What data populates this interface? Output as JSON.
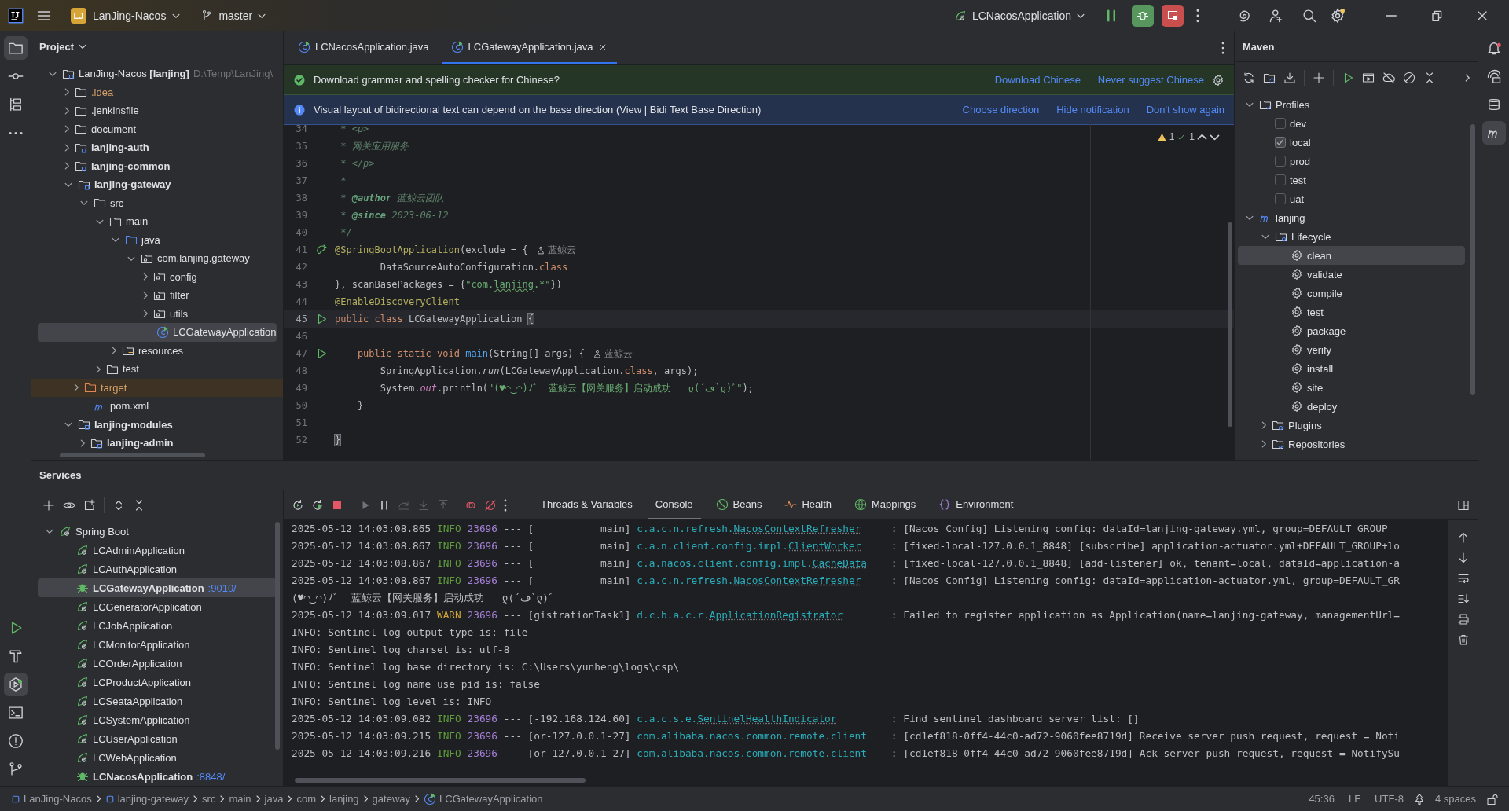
{
  "toolbar": {
    "project_badge": "LJ",
    "project": "LanJing-Nacos",
    "branch": "master",
    "run_config": "LCNacosApplication"
  },
  "project": {
    "title": "Project",
    "tree": [
      {
        "label": "LanJing-Nacos **[lanjing]**",
        "path": "D:\\Temp\\LanJing\\",
        "kind": "project",
        "expanded": true,
        "selected": false,
        "children": [
          {
            "label": ".idea",
            "kind": "ignored-folder",
            "expanded": false,
            "selected": false
          },
          {
            "label": ".jenkinsfile",
            "kind": "folder",
            "expanded": false,
            "selected": false
          },
          {
            "label": "document",
            "kind": "folder",
            "expanded": false,
            "selected": false
          },
          {
            "label": "lanjing-auth",
            "kind": "module",
            "expanded": false,
            "selected": false
          },
          {
            "label": "lanjing-common",
            "kind": "module",
            "expanded": false,
            "selected": false
          },
          {
            "label": "lanjing-gateway",
            "kind": "module",
            "expanded": true,
            "selected": false,
            "children": [
              {
                "label": "src",
                "kind": "folder",
                "expanded": true,
                "selected": false,
                "children": [
                  {
                    "label": "main",
                    "kind": "folder",
                    "expanded": true,
                    "selected": false,
                    "children": [
                      {
                        "label": "java",
                        "kind": "source-root",
                        "expanded": true,
                        "selected": false,
                        "children": [
                          {
                            "label": "com.lanjing.gateway",
                            "kind": "package",
                            "expanded": true,
                            "selected": false,
                            "children": [
                              {
                                "label": "config",
                                "kind": "package",
                                "expanded": false,
                                "selected": false
                              },
                              {
                                "label": "filter",
                                "kind": "package",
                                "expanded": false,
                                "selected": false
                              },
                              {
                                "label": "utils",
                                "kind": "package",
                                "expanded": false,
                                "selected": false
                              },
                              {
                                "label": "LCGatewayApplication",
                                "kind": "class",
                                "selected": true
                              }
                            ]
                          }
                        ]
                      },
                      {
                        "label": "resources",
                        "kind": "resources",
                        "expanded": false,
                        "selected": false
                      }
                    ]
                  },
                  {
                    "label": "test",
                    "kind": "folder",
                    "expanded": false,
                    "selected": false
                  }
                ]
              },
              {
                "label": "target",
                "kind": "excluded-folder",
                "expanded": false,
                "selected": false
              },
              {
                "label": "pom.xml",
                "kind": "maven-file",
                "selected": false
              }
            ]
          },
          {
            "label": "lanjing-modules",
            "kind": "module",
            "expanded": true,
            "selected": false,
            "children": [
              {
                "label": "lanjing-admin",
                "kind": "module",
                "expanded": false,
                "selected": false
              }
            ]
          }
        ]
      }
    ]
  },
  "editor": {
    "tabs": [
      {
        "label": "LCNacosApplication.java",
        "selected": false,
        "closable": false
      },
      {
        "label": "LCGatewayApplication.java",
        "selected": true,
        "closable": true
      }
    ],
    "notifications": [
      {
        "kind": "success",
        "text": "Download grammar and spelling checker for Chinese?",
        "actions": [
          "Download Chinese",
          "Never suggest Chinese"
        ],
        "settings": true
      },
      {
        "kind": "info",
        "text": "Visual layout of bidirectional text can depend on the base direction (View | Bidi Text Base Direction)",
        "actions": [
          "Choose direction",
          "Hide notification",
          "Don't show again"
        ],
        "settings": false
      }
    ],
    "inspections": {
      "warnings": "1",
      "checks": "1"
    },
    "lines": [
      {
        "number": "34",
        "current": false,
        "tokens": [
          {
            "kind": "doc",
            "text": " * <p>"
          }
        ]
      },
      {
        "number": "35",
        "current": false,
        "tokens": [
          {
            "kind": "doc",
            "text": " * 网关应用服务"
          }
        ]
      },
      {
        "number": "36",
        "current": false,
        "tokens": [
          {
            "kind": "doc",
            "text": " * </p>"
          }
        ]
      },
      {
        "number": "37",
        "current": false,
        "tokens": [
          {
            "kind": "doc",
            "text": " *"
          }
        ]
      },
      {
        "number": "38",
        "current": false,
        "tokens": [
          {
            "kind": "doc",
            "text": " * "
          },
          {
            "kind": "doctag",
            "text": "@author"
          },
          {
            "kind": "doc",
            "text": " 蓝鲸云团队"
          }
        ]
      },
      {
        "number": "39",
        "current": false,
        "tokens": [
          {
            "kind": "doc",
            "text": " * "
          },
          {
            "kind": "doctag",
            "text": "@since"
          },
          {
            "kind": "doc",
            "text": " 2023-06-12"
          }
        ]
      },
      {
        "number": "40",
        "current": false,
        "tokens": [
          {
            "kind": "doc",
            "text": " */"
          }
        ]
      },
      {
        "number": "41",
        "current": false,
        "gutter": {
          "kind": "bean"
        },
        "hint": "蓝鲸云",
        "tokens": [
          {
            "kind": "annotation",
            "text": "@SpringBootApplication"
          },
          {
            "kind": "plain",
            "text": "(exclude = {"
          }
        ]
      },
      {
        "number": "42",
        "current": false,
        "tokens": [
          {
            "kind": "plain",
            "text": "        DataSourceAutoConfiguration."
          },
          {
            "kind": "keyword",
            "text": "class"
          }
        ]
      },
      {
        "number": "43",
        "current": false,
        "tokens": [
          {
            "kind": "plain",
            "text": "}, scanBasePackages = {"
          },
          {
            "kind": "string",
            "text": "\"com."
          },
          {
            "kind": "typo",
            "text": "lanjing"
          },
          {
            "kind": "string",
            "text": ".*\""
          },
          {
            "kind": "plain",
            "text": "})"
          }
        ]
      },
      {
        "number": "44",
        "current": false,
        "tokens": [
          {
            "kind": "annotation",
            "text": "@EnableDiscoveryClient"
          }
        ]
      },
      {
        "number": "45",
        "current": true,
        "gutter": {
          "kind": "run"
        },
        "tokens": [
          {
            "kind": "keyword",
            "text": "public class "
          },
          {
            "kind": "plain",
            "text": "LCGatewayApplication "
          },
          {
            "kind": "brace",
            "text": "{"
          }
        ]
      },
      {
        "number": "46",
        "current": false
      },
      {
        "number": "47",
        "current": false,
        "gutter": {
          "kind": "run"
        },
        "hint": "蓝鲸云",
        "tokens": [
          {
            "kind": "keyword",
            "text": "    public static void "
          },
          {
            "kind": "method",
            "text": "main"
          },
          {
            "kind": "plain",
            "text": "(String[] args) {"
          }
        ]
      },
      {
        "number": "48",
        "current": false,
        "tokens": [
          {
            "kind": "plain",
            "text": "        SpringApplication."
          },
          {
            "kind": "static-call",
            "text": "run"
          },
          {
            "kind": "plain",
            "text": "(LCGatewayApplication."
          },
          {
            "kind": "keyword",
            "text": "class"
          },
          {
            "kind": "plain",
            "text": ", args);"
          }
        ]
      },
      {
        "number": "49",
        "current": false,
        "tokens": [
          {
            "kind": "plain",
            "text": "        System."
          },
          {
            "kind": "static-field",
            "text": "out"
          },
          {
            "kind": "plain",
            "text": ".println("
          },
          {
            "kind": "string",
            "text": "\"(♥◠‿◠)ﾉﾞ  蓝鲸云【网关服务】启动成功   ლ(´ڡ`ლ)ﾞ\""
          },
          {
            "kind": "plain",
            "text": ");"
          }
        ]
      },
      {
        "number": "50",
        "current": false,
        "tokens": [
          {
            "kind": "plain",
            "text": "    }"
          }
        ]
      },
      {
        "number": "51",
        "current": false
      },
      {
        "number": "52",
        "current": false,
        "tokens": [
          {
            "kind": "brace",
            "text": "}"
          }
        ]
      }
    ]
  },
  "maven": {
    "title": "Maven",
    "tree": [
      {
        "label": "Profiles",
        "kind": "profiles",
        "expanded": true,
        "selected": false,
        "children": [
          {
            "label": "dev",
            "kind": "profile",
            "checked": false,
            "selected": false
          },
          {
            "label": "local",
            "kind": "profile",
            "checked": true,
            "selected": false
          },
          {
            "label": "prod",
            "kind": "profile",
            "checked": false,
            "selected": false
          },
          {
            "label": "test",
            "kind": "profile",
            "checked": false,
            "selected": false
          },
          {
            "label": "uat",
            "kind": "profile",
            "checked": false,
            "selected": false
          }
        ]
      },
      {
        "label": "lanjing",
        "kind": "project",
        "expanded": true,
        "selected": false,
        "children": [
          {
            "label": "Lifecycle",
            "kind": "lifecycle",
            "expanded": true,
            "selected": false,
            "children": [
              {
                "label": "clean",
                "kind": "goal",
                "selected": true
              },
              {
                "label": "validate",
                "kind": "goal",
                "selected": false
              },
              {
                "label": "compile",
                "kind": "goal",
                "selected": false
              },
              {
                "label": "test",
                "kind": "goal",
                "selected": false
              },
              {
                "label": "package",
                "kind": "goal",
                "selected": false
              },
              {
                "label": "verify",
                "kind": "goal",
                "selected": false
              },
              {
                "label": "install",
                "kind": "goal",
                "selected": false
              },
              {
                "label": "site",
                "kind": "goal",
                "selected": false
              },
              {
                "label": "deploy",
                "kind": "goal",
                "selected": false
              }
            ]
          },
          {
            "label": "Plugins",
            "kind": "lifecycle",
            "expanded": false,
            "selected": false
          },
          {
            "label": "Repositories",
            "kind": "repositories",
            "expanded": false,
            "selected": false
          }
        ]
      }
    ]
  },
  "services": {
    "title": "Services",
    "tree": [
      {
        "label": "Spring Boot",
        "kind": "group",
        "expanded": true,
        "selected": false,
        "children": [
          {
            "label": "LCAdminApplication",
            "kind": "app",
            "running": false,
            "selected": false
          },
          {
            "label": "LCAuthApplication",
            "kind": "app",
            "running": false,
            "selected": false
          },
          {
            "label": "LCGatewayApplication",
            "kind": "app",
            "running": true,
            "port": ":9010/",
            "selected": true
          },
          {
            "label": "LCGeneratorApplication",
            "kind": "app",
            "running": false,
            "selected": false
          },
          {
            "label": "LCJobApplication",
            "kind": "app",
            "running": false,
            "selected": false
          },
          {
            "label": "LCMonitorApplication",
            "kind": "app",
            "running": false,
            "selected": false
          },
          {
            "label": "LCOrderApplication",
            "kind": "app",
            "running": false,
            "selected": false
          },
          {
            "label": "LCProductApplication",
            "kind": "app",
            "running": false,
            "selected": false
          },
          {
            "label": "LCSeataApplication",
            "kind": "app",
            "running": false,
            "selected": false
          },
          {
            "label": "LCSystemApplication",
            "kind": "app",
            "running": false,
            "selected": false
          },
          {
            "label": "LCUserApplication",
            "kind": "app",
            "running": false,
            "selected": false
          },
          {
            "label": "LCWebApplication",
            "kind": "app",
            "running": false,
            "selected": false
          },
          {
            "label": "LCNacosApplication",
            "kind": "app",
            "running": true,
            "port": ":8848/",
            "selected": false
          }
        ]
      }
    ]
  },
  "console": {
    "tabs": [
      {
        "label": "Threads & Variables",
        "kind": "threads",
        "selected": false
      },
      {
        "label": "Console",
        "kind": "console",
        "selected": true
      },
      {
        "label": "Beans",
        "kind": "beans",
        "selected": false
      },
      {
        "label": "Health",
        "kind": "health",
        "selected": false
      },
      {
        "label": "Mappings",
        "kind": "mappings",
        "selected": false
      },
      {
        "label": "Environment",
        "kind": "environment",
        "selected": false
      }
    ],
    "lines": [
      {
        "kind": "log",
        "time": "2025-05-12 14:03:08.865",
        "level": "INFO",
        "pid": "23696",
        "sep": "---",
        "thread": "[           main]",
        "logger": "c.a.c.n.refresh.",
        "logger_class": "NacosContextRefresher",
        "message": ": [Nacos Config] Listening config: dataId=lanjing-gateway.yml, group=DEFAULT_GROUP"
      },
      {
        "kind": "log",
        "time": "2025-05-12 14:03:08.867",
        "level": "INFO",
        "pid": "23696",
        "sep": "---",
        "thread": "[           main]",
        "logger": "c.a.n.client.config.impl.",
        "logger_class": "ClientWorker",
        "message": ": [fixed-local-127.0.0.1_8848] [subscribe] application-actuator.yml+DEFAULT_GROUP+lo"
      },
      {
        "kind": "log",
        "time": "2025-05-12 14:03:08.867",
        "level": "INFO",
        "pid": "23696",
        "sep": "---",
        "thread": "[           main]",
        "logger": "c.a.nacos.client.config.impl.",
        "logger_class": "CacheData",
        "message": ": [fixed-local-127.0.0.1_8848] [add-listener] ok, tenant=local, dataId=application-a"
      },
      {
        "kind": "log",
        "time": "2025-05-12 14:03:08.867",
        "level": "INFO",
        "pid": "23696",
        "sep": "---",
        "thread": "[           main]",
        "logger": "c.a.c.n.refresh.",
        "logger_class": "NacosContextRefresher",
        "message": ": [Nacos Config] Listening config: dataId=application-actuator.yml, group=DEFAULT_GR"
      },
      {
        "kind": "text",
        "text": "(♥◠‿◠)ﾉﾞ  蓝鲸云【网关服务】启动成功   ლ(´ڡ`ლ)ﾞ"
      },
      {
        "kind": "log",
        "time": "2025-05-12 14:03:09.017",
        "level": "WARN",
        "pid": "23696",
        "sep": "---",
        "thread": "[gistrationTask1]",
        "logger": "d.c.b.a.c.r.",
        "logger_class": "ApplicationRegistrator",
        "message": ": Failed to register application as Application(name=lanjing-gateway, managementUrl="
      },
      {
        "kind": "text",
        "text": "INFO: Sentinel log output type is: file"
      },
      {
        "kind": "text",
        "text": "INFO: Sentinel log charset is: utf-8"
      },
      {
        "kind": "text",
        "text": "INFO: Sentinel log base directory is: C:\\Users\\yunheng\\logs\\csp\\"
      },
      {
        "kind": "text",
        "text": "INFO: Sentinel log name use pid is: false"
      },
      {
        "kind": "text",
        "text": "INFO: Sentinel log level is: INFO"
      },
      {
        "kind": "log",
        "time": "2025-05-12 14:03:09.082",
        "level": "INFO",
        "pid": "23696",
        "sep": "---",
        "thread": "[-192.168.124.60]",
        "logger": "c.a.c.s.e.",
        "logger_class": "SentinelHealthIndicator",
        "message": ": Find sentinel dashboard server list: []"
      },
      {
        "kind": "log",
        "time": "2025-05-12 14:03:09.215",
        "level": "INFO",
        "pid": "23696",
        "sep": "---",
        "thread": "[or-127.0.0.1-27]",
        "logger": "com.alibaba.nacos.common.remote.client",
        "message": ": [cd1ef818-0ff4-44c0-ad72-9060fee8719d] Receive server push request, request = Noti"
      },
      {
        "kind": "log",
        "time": "2025-05-12 14:03:09.216",
        "level": "INFO",
        "pid": "23696",
        "sep": "---",
        "thread": "[or-127.0.0.1-27]",
        "logger": "com.alibaba.nacos.common.remote.client",
        "message": ": [cd1ef818-0ff4-44c0-ad72-9060fee8719d] Ack server push request, request = NotifySu"
      }
    ]
  },
  "status_bar": {
    "breadcrumbs": [
      {
        "label": "LanJing-Nacos",
        "kind": "module"
      },
      {
        "label": "lanjing-gateway",
        "kind": "module"
      },
      {
        "label": "src",
        "kind": "folder"
      },
      {
        "label": "main",
        "kind": "folder"
      },
      {
        "label": "java",
        "kind": "folder"
      },
      {
        "label": "com",
        "kind": "folder"
      },
      {
        "label": "lanjing",
        "kind": "folder"
      },
      {
        "label": "gateway",
        "kind": "folder"
      },
      {
        "label": "LCGatewayApplication",
        "kind": "class"
      }
    ],
    "position": "45:36",
    "line_ending": "LF",
    "encoding": "UTF-8",
    "indent": "4 spaces"
  }
}
